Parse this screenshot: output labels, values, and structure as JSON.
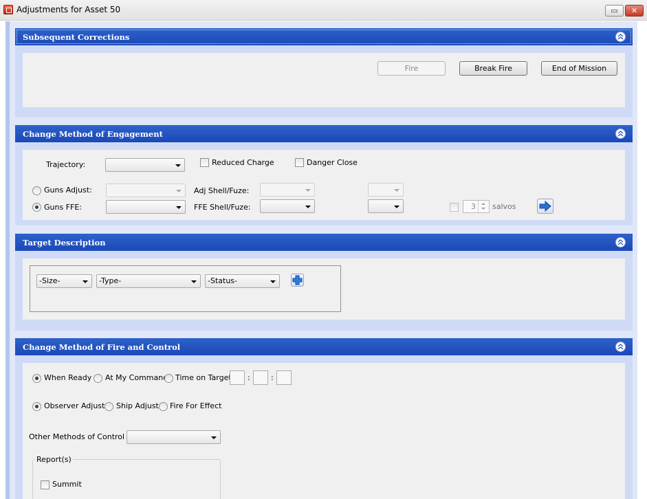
{
  "window": {
    "title": "Adjustments for Asset 50",
    "minimize_glyph": "▭",
    "close_glyph": "✕"
  },
  "subsequent_corrections": {
    "header": "Subsequent Corrections",
    "fire_label": "Fire",
    "break_fire_label": "Break Fire",
    "end_of_mission_label": "End of Mission"
  },
  "change_method_engagement": {
    "header": "Change Method of Engagement",
    "trajectory_label": "Trajectory:",
    "trajectory_value": "",
    "reduced_charge_label": "Reduced Charge",
    "danger_close_label": "Danger Close",
    "guns_adjust_label": "Guns Adjust:",
    "guns_ffe_label": "Guns FFE:",
    "adj_shell_fuze_label": "Adj Shell/Fuze:",
    "ffe_shell_fuze_label": "FFE Shell/Fuze:",
    "salvos_value": "3",
    "salvos_label": "salvos"
  },
  "target_description": {
    "header": "Target Description",
    "size_value": "-Size-",
    "type_value": "-Type-",
    "status_value": "-Status-"
  },
  "change_method_fire_control": {
    "header": "Change Method of Fire and Control",
    "when_ready_label": "When Ready",
    "at_my_command_label": "At My Command",
    "time_on_target_label": "Time on Target",
    "time_separator": ":",
    "observer_adjust_label": "Observer Adjust",
    "ship_adjust_label": "Ship Adjust",
    "fire_for_effect_label": "Fire For Effect",
    "other_methods_label": "Other Methods of Control",
    "other_methods_value": "",
    "reports_label": "Report(s)",
    "summit_label": "Summit"
  },
  "colors": {
    "header_blue": "#1b49b8",
    "panel_bg": "#cfdbf6",
    "body_bg": "#f0f0f0",
    "close_red": "#c53a25"
  },
  "icons": [
    "app-icon",
    "minimize-icon",
    "close-icon",
    "collapse-chevron-icon",
    "arrow-right-icon",
    "plus-icon",
    "spinner-icon"
  ]
}
